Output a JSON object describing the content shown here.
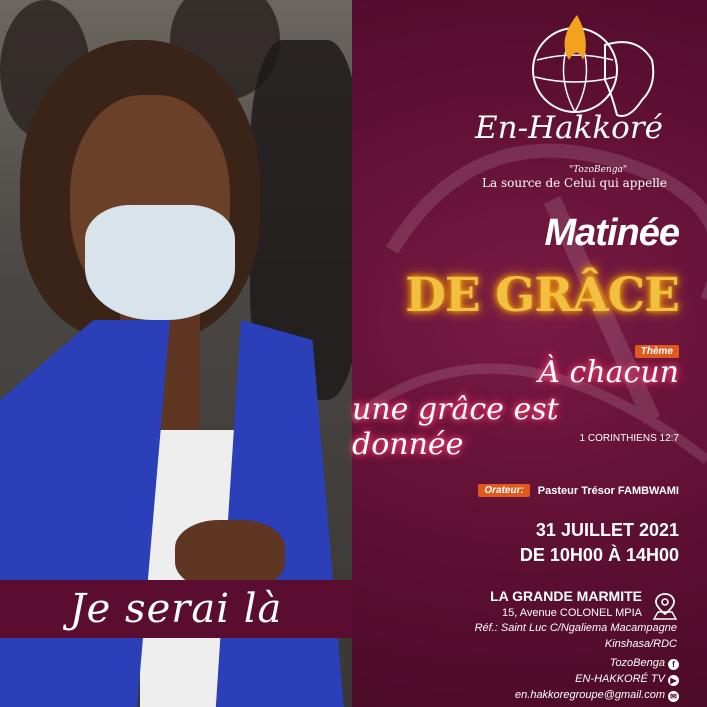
{
  "photo_banner": {
    "text": "Je serai là"
  },
  "brand": {
    "name": "En-Hakkoré",
    "subtitle": "\"TozoBenga\"",
    "tagline": "La source de Celui qui appelle",
    "logo_icon": "globe-flame-africa-logo"
  },
  "event": {
    "title_line1": "Matinée",
    "title_line2": "DE GRÂCE"
  },
  "theme": {
    "tag": "Thème",
    "line1": "À chacun",
    "line2": "une grâce est donnée",
    "verse": "1 CORINTHIENS 12:7"
  },
  "orator": {
    "tag": "Orateur:",
    "name": "Pasteur Trésor FAMBWAMI"
  },
  "schedule": {
    "date": "31 JUILLET 2021",
    "time": "DE 10H00 À 14H00"
  },
  "venue": {
    "name": "LA GRANDE MARMITE",
    "address": "15, Avenue COLONEL MPIA",
    "ref": "Réf.: Saint Luc C/Ngaliema Macampagne",
    "city": "Kinshasa/RDC",
    "pin_icon": "location-pin-icon"
  },
  "social": [
    {
      "label": "TozoBenga",
      "icon": "facebook-icon"
    },
    {
      "label": "EN-HAKKORÉ TV",
      "icon": "youtube-icon"
    },
    {
      "label": "en.hakkoregroupe@gmail.com",
      "icon": "email-icon"
    }
  ],
  "colors": {
    "background": "#5a0d2e",
    "accent_gold": "#f2c041",
    "accent_orange": "#e05a1e",
    "vest_blue": "#2a3fb8"
  }
}
